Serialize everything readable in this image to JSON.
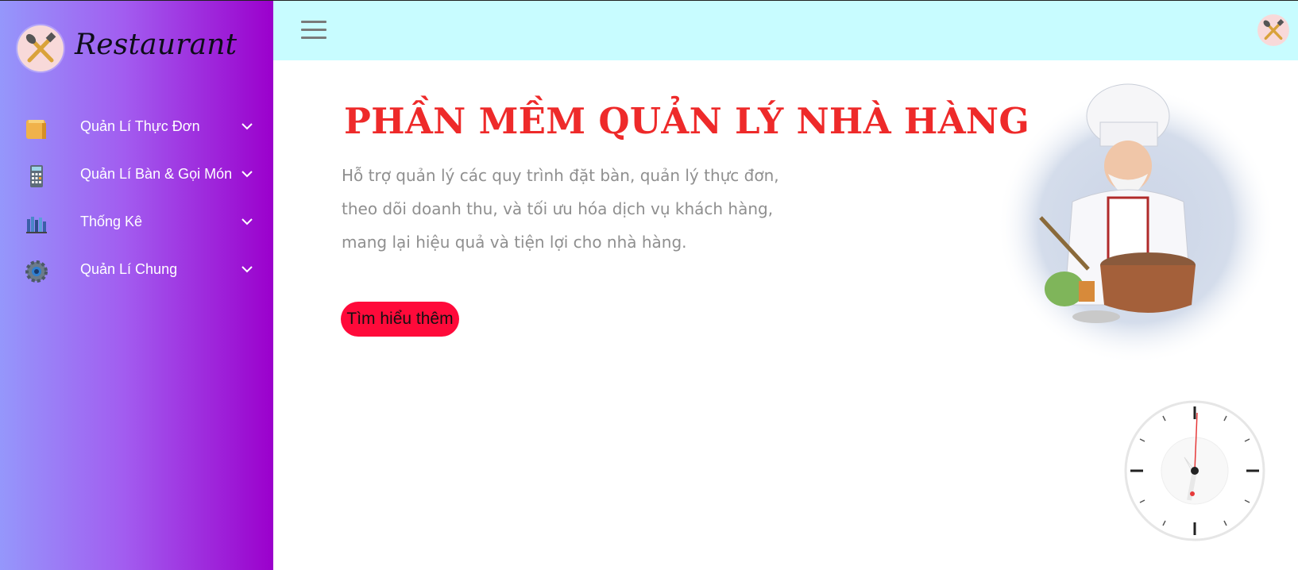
{
  "sidebar": {
    "brand": "Restaurant",
    "logo_icon": "crossed-spoon-fork-icon",
    "items": [
      {
        "label": "Quản Lí Thực Đơn",
        "icon": "menu-book-icon"
      },
      {
        "label": "Quản Lí Bàn & Gọi Món",
        "icon": "calculator-icon"
      },
      {
        "label": "Thống Kê",
        "icon": "books-chart-icon"
      },
      {
        "label": "Quản Lí Chung",
        "icon": "gear-icon"
      }
    ]
  },
  "topbar": {
    "menu_icon": "hamburger-icon",
    "logo_icon": "crossed-spoon-fork-icon"
  },
  "hero": {
    "title": "PHẦN MỀM QUẢN LÝ NHÀ HÀNG",
    "description": "Hỗ trợ quản lý các quy trình đặt bàn, quản lý thực đơn, theo dõi doanh thu, và tối ưu hóa dịch vụ khách hàng, mang lại hiệu quả và tiện lợi cho nhà hàng.",
    "cta_label": "Tìm hiểu thêm"
  },
  "colors": {
    "sidebar_gradient": [
      "#9597fb",
      "#a25df0",
      "#9b00cc"
    ],
    "topbar": "#c8fcff",
    "title": "#ee2a2a",
    "cta": "#ff0a3a"
  }
}
